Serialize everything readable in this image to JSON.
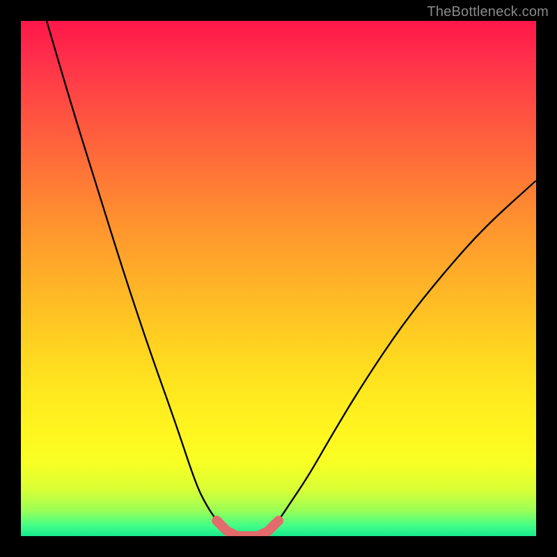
{
  "watermark": {
    "text": "TheBottleneck.com"
  },
  "chart_data": {
    "type": "line",
    "title": "",
    "xlabel": "",
    "ylabel": "",
    "xlim": [
      0,
      100
    ],
    "ylim": [
      0,
      100
    ],
    "series": [
      {
        "name": "left-curve",
        "x": [
          5,
          10,
          15,
          20,
          25,
          30,
          34,
          36,
          38,
          40
        ],
        "values": [
          100,
          83,
          67,
          51,
          36,
          22,
          10,
          6,
          3,
          1
        ]
      },
      {
        "name": "right-curve",
        "x": [
          48,
          50,
          52,
          56,
          60,
          66,
          74,
          82,
          90,
          100
        ],
        "values": [
          1,
          3,
          6,
          12,
          19,
          29,
          41,
          51,
          60,
          69
        ]
      },
      {
        "name": "valley-highlight",
        "x": [
          38,
          40,
          42,
          44,
          46,
          48,
          50
        ],
        "values": [
          3,
          1,
          0,
          0,
          0,
          1,
          3
        ]
      }
    ],
    "colors": {
      "curve": "#000000",
      "highlight": "#e36b6b"
    }
  }
}
